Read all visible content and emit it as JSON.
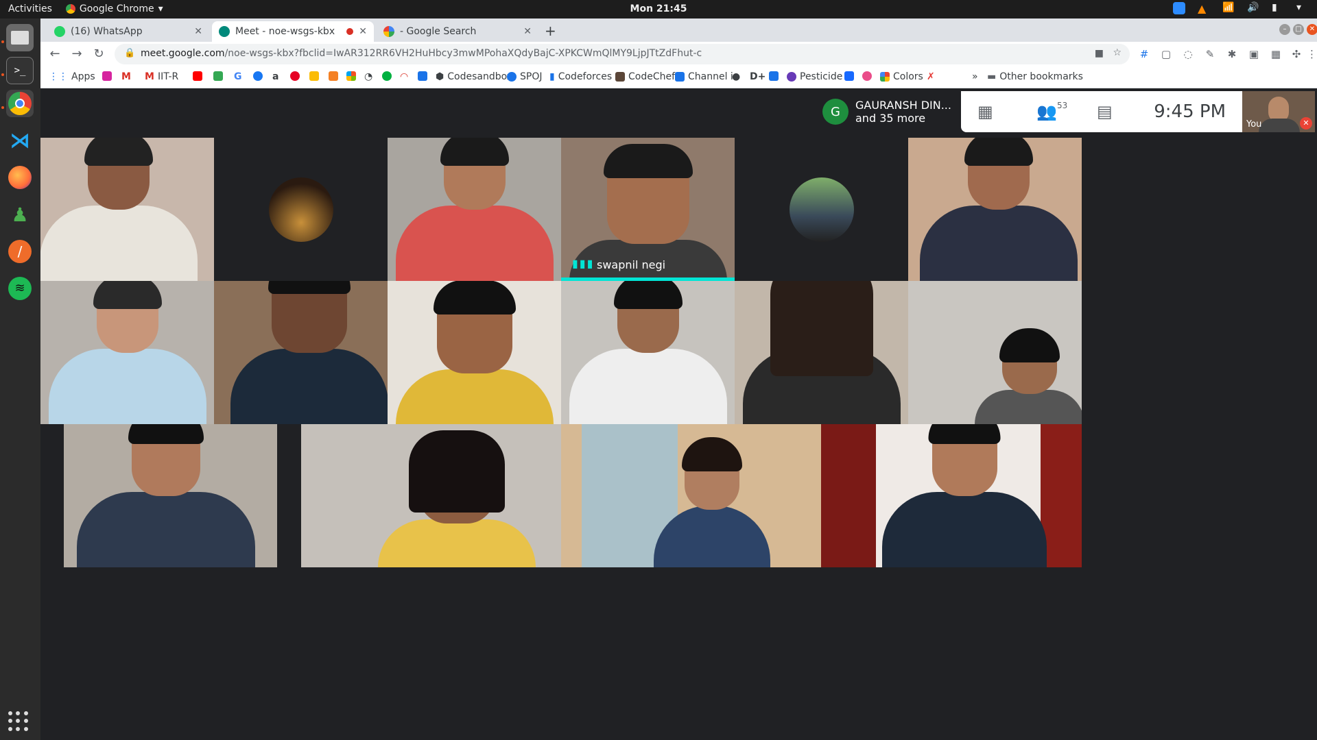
{
  "topbar": {
    "activities": "Activities",
    "app_name": "Google Chrome",
    "clock": "Mon 21:45"
  },
  "tabs": [
    {
      "title": "(16) WhatsApp",
      "active": false
    },
    {
      "title": "Meet - noe-wsgs-kbx",
      "active": true
    },
    {
      "title": "- Google Search",
      "active": false
    }
  ],
  "omnibox": {
    "host": "meet.google.com",
    "path": "/noe-wsgs-kbx?fbclid=IwAR312RR6VH2HuHbcy3mwMPohaXQdyBajC-XPKCWmQlMY9LjpJTtZdFhut-c"
  },
  "bookmarks": {
    "apps": "Apps",
    "iitr": "IIT-R",
    "codesandbox": "Codesandbox",
    "spoj": "SPOJ",
    "codeforces": "Codeforces",
    "codechef": "CodeChef",
    "channel": "Channel i",
    "pesticide": "Pesticide",
    "colors": "Colors",
    "overflow": "»",
    "other": "Other bookmarks"
  },
  "meet": {
    "presenter_initial": "G",
    "presenter_name": "GAURANSH DIN...",
    "presenter_more": "and 35 more",
    "participant_count": "53",
    "time": "9:45 PM",
    "self_label": "You",
    "speaking_name": "swapnil negi"
  },
  "colors": {
    "meet_bg": "#202124",
    "speaking_accent": "#00e5d5",
    "presenter_avatar": "#1e8e3e",
    "mic_off": "#ea4335"
  }
}
